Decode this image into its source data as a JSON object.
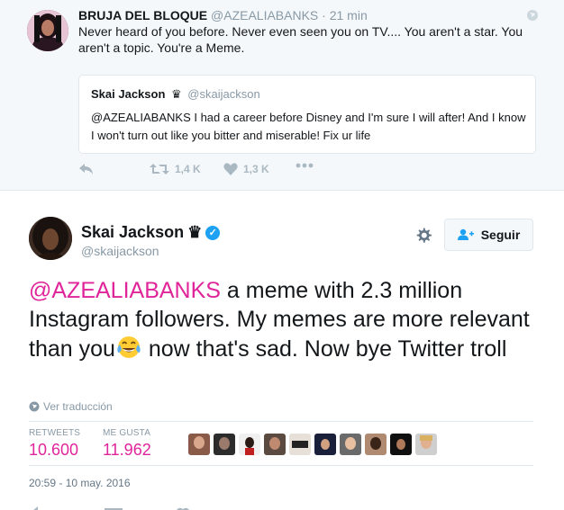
{
  "reply_tweet": {
    "author_name": "BRUJA DEL BLOQUE",
    "author_handle": "@AZEALIABANKS",
    "time": "· 21 min",
    "text": "Never heard of you before. Never even seen you on TV.... You aren't a star. You aren't a topic. You're a Meme.",
    "quote": {
      "author_name": "Skai Jackson",
      "author_handle": "@skaijackson",
      "text": "@AZEALIABANKS I had a career before Disney and I'm sure I will after! And I know I won't turn out like you bitter and miserable! Fix ur life"
    },
    "actions": {
      "reply_icon": "reply-icon",
      "retweet_icon": "retweet-icon",
      "retweet_count": "1,4 K",
      "like_icon": "heart-icon",
      "like_count": "1,3 K",
      "more_icon": "more-icon"
    }
  },
  "main_tweet": {
    "author_name": "Skai Jackson",
    "crown": "♛",
    "author_handle": "@skaijackson",
    "follow_label": "Seguir",
    "text_mention": "@AZEALIABANKS",
    "text_part1": " a meme with 2.3 million Instagram followers. My memes are more relevant than you",
    "text_part2": " now that's sad. Now bye Twitter troll",
    "translate_label": "Ver traducción",
    "stats": {
      "retweets_label": "RETWEETS",
      "retweets_value": "10.600",
      "likes_label": "ME GUSTA",
      "likes_value": "11.962"
    },
    "timestamp": "20:59 - 10 may. 2016"
  },
  "colors": {
    "accent_pink": "#e0249a",
    "verified_blue": "#1da1f2",
    "muted": "#8899a6",
    "reply_bg": "#f5f8fa"
  }
}
